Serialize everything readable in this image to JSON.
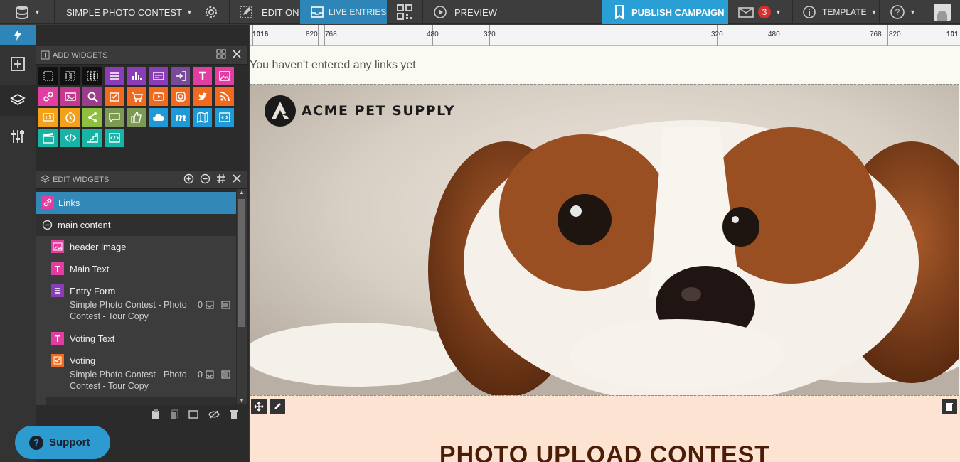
{
  "topbar": {
    "campaign_name": "SIMPLE PHOTO CONTEST",
    "edit_on": "EDIT ON",
    "live_entries": "LIVE ENTRIES",
    "preview": "PREVIEW",
    "publish": "PUBLISH CAMPAIGN",
    "notification_count": "3",
    "template": "TEMPLATE"
  },
  "add_widgets": {
    "title": "ADD WIDGETS",
    "icons": [
      {
        "name": "layout-1col-icon",
        "color": "#111111"
      },
      {
        "name": "layout-2col-icon",
        "color": "#111111"
      },
      {
        "name": "layout-3col-icon",
        "color": "#111111"
      },
      {
        "name": "form-icon",
        "color": "#8a3db6"
      },
      {
        "name": "chart-icon",
        "color": "#8a3db6"
      },
      {
        "name": "card-icon",
        "color": "#8a3db6"
      },
      {
        "name": "login-icon",
        "color": "#7a4a9a"
      },
      {
        "name": "text-icon",
        "color": "#e23ea1"
      },
      {
        "name": "image-icon",
        "color": "#e23ea1"
      },
      {
        "name": "link-icon",
        "color": "#e23ea1"
      },
      {
        "name": "gallery-icon",
        "color": "#c4398f"
      },
      {
        "name": "search-icon",
        "color": "#9a3d8a"
      },
      {
        "name": "vote-icon",
        "color": "#ef6a1f"
      },
      {
        "name": "cart-icon",
        "color": "#ef6a1f"
      },
      {
        "name": "video-icon",
        "color": "#ef6a1f"
      },
      {
        "name": "instagram-icon",
        "color": "#ef6a1f"
      },
      {
        "name": "twitter-icon",
        "color": "#ef6a1f"
      },
      {
        "name": "rss-icon",
        "color": "#ef6a1f"
      },
      {
        "name": "counter-icon",
        "color": "#f3a11c"
      },
      {
        "name": "timer-icon",
        "color": "#f3a11c"
      },
      {
        "name": "share-icon",
        "color": "#8fbf3e"
      },
      {
        "name": "comment-icon",
        "color": "#7c9a53"
      },
      {
        "name": "like-icon",
        "color": "#7c9a53"
      },
      {
        "name": "cloud-icon",
        "color": "#1f9ad6"
      },
      {
        "name": "m-logo-icon",
        "color": "#1f9ad6"
      },
      {
        "name": "map-icon",
        "color": "#1f9ad6"
      },
      {
        "name": "embed-icon",
        "color": "#1f9ad6"
      },
      {
        "name": "clapper-icon",
        "color": "#17b3a4"
      },
      {
        "name": "code-icon",
        "color": "#17b3a4"
      },
      {
        "name": "stairs-icon",
        "color": "#17b3a4"
      },
      {
        "name": "html-icon",
        "color": "#17b3a4"
      }
    ]
  },
  "edit_widgets": {
    "title": "EDIT WIDGETS",
    "selected": "Links",
    "group": "main content",
    "items": [
      {
        "label": "header image",
        "sub": ""
      },
      {
        "label": "Main Text",
        "sub": ""
      },
      {
        "label": "Entry Form",
        "sub": "Simple Photo Contest - Photo Contest - Tour Copy",
        "count": "0"
      },
      {
        "label": "Voting Text",
        "sub": ""
      },
      {
        "label": "Voting",
        "sub": "Simple Photo Contest - Photo Contest - Tour Copy",
        "count": "0"
      }
    ]
  },
  "support": {
    "label": "Support"
  },
  "ruler": {
    "labels": [
      "1016",
      "820",
      "768",
      "480",
      "320",
      "320",
      "480",
      "768",
      "820",
      "101"
    ]
  },
  "canvas": {
    "links_empty": "You haven't entered any links yet",
    "logo_text": "ACME PET SUPPLY",
    "section_title": "PHOTO UPLOAD CONTEST"
  },
  "colors": {
    "accent": "#2a9fd6",
    "selected_row": "#3288b6",
    "lower_bg": "#fde3d2",
    "title_brown": "#4a1d06"
  }
}
